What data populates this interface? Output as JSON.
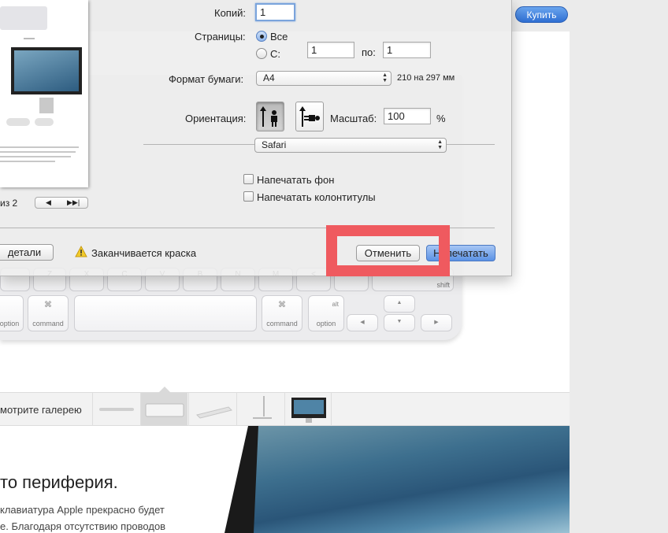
{
  "background": {
    "buy_label": "Купить",
    "keyboard_keys": [
      {
        "sym": "",
        "sub": "option"
      },
      {
        "sym": "⌘",
        "sub": "command"
      },
      {
        "sym": "⌘",
        "sub": "command"
      },
      {
        "sym": "alt",
        "sub": "option"
      },
      {
        "sym": "",
        "sub": "shift"
      }
    ],
    "key_letters": [
      "Z",
      "X",
      "C",
      "V",
      "B",
      "N",
      "M",
      "<",
      ">",
      "?"
    ],
    "arrows": {
      "up": "▲",
      "down": "▼",
      "left": "◀",
      "right": "▶"
    },
    "gallery_link": "мотрите галерею",
    "headline": "то периферия.",
    "paragraph_lines": [
      "клавиатура Apple прекрасно будет",
      "е. Благодаря отсутствию проводов"
    ]
  },
  "dialog": {
    "page_indicator": "из 2",
    "pager_prev": "◀",
    "pager_next": "▶▶|",
    "copies_label": "Копий:",
    "copies_value": "1",
    "pages_label": "Страницы:",
    "pages_all_label": "Все",
    "pages_from_label": "С:",
    "pages_from_value": "1",
    "pages_to_label": "по:",
    "pages_to_value": "1",
    "paper_label": "Формат бумаги:",
    "paper_value": "A4",
    "paper_dimensions": "210 на 297 мм",
    "orientation_label": "Ориентация:",
    "scale_label": "Масштаб:",
    "scale_value": "100",
    "scale_unit": "%",
    "app_select_value": "Safari",
    "print_backgrounds_label": "Напечатать фон",
    "print_headers_footers_label": "Напечатать колонтитулы",
    "details_button_label": "детали",
    "ink_warning": "Заканчивается краска",
    "cancel_button_label": "Отменить",
    "print_button_label": "Напечатать"
  },
  "colors": {
    "highlight": "#ef5a5f",
    "default_button": "#5b92e5"
  }
}
